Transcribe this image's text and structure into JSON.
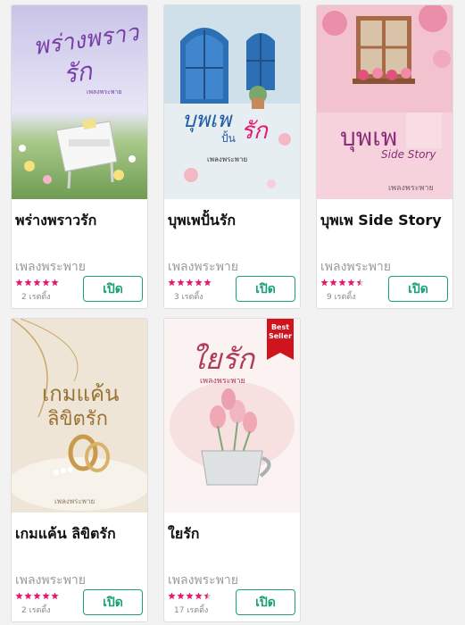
{
  "books": [
    {
      "title": "พร่างพราวรัก",
      "author": "เพลงพระพาย",
      "rating_stars": 5,
      "rating_text": "2 เรตติ้ง",
      "open_label": "เปิด",
      "cover_lines": [
        "พร่างพราว",
        "รัก",
        "เพลงพระพาย"
      ]
    },
    {
      "title": "บุพเพปั้นรัก",
      "author": "เพลงพระพาย",
      "rating_stars": 5,
      "rating_text": "3 เรตติ้ง",
      "open_label": "เปิด",
      "cover_lines": [
        "บุพเพ",
        "ปั้น",
        "รัก",
        "เพลงพระพาย"
      ]
    },
    {
      "title": "บุพเพ Side Story",
      "author": "เพลงพระพาย",
      "rating_stars": 4.5,
      "rating_text": "9 เรตติ้ง",
      "open_label": "เปิด",
      "cover_lines": [
        "บุพเพ",
        "Side Story",
        "เพลงพระพาย"
      ]
    },
    {
      "title": "เกมแค้น ลิขิตรัก",
      "author": "เพลงพระพาย",
      "rating_stars": 5,
      "rating_text": "2 เรตติ้ง",
      "open_label": "เปิด",
      "cover_lines": [
        "เกมแค้น",
        "ลิขิตรัก",
        "เพลงพระพาย"
      ]
    },
    {
      "title": "ใยรัก",
      "author": "เพลงพระพาย",
      "rating_stars": 4.5,
      "rating_text": "17 เรตติ้ง",
      "open_label": "เปิด",
      "cover_lines": [
        "ใยรัก",
        "เพลงพระพาย"
      ],
      "badge": [
        "Best",
        "Seller"
      ]
    }
  ],
  "colors": {
    "accent": "#1aa079",
    "star": "#e8186d",
    "star_empty": "#cfcfcf",
    "badge": "#d0141e"
  }
}
